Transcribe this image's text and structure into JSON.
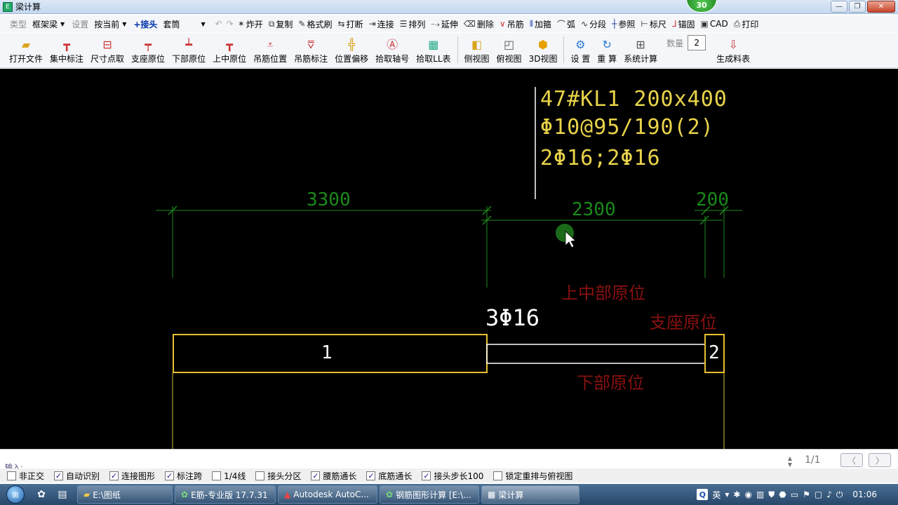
{
  "window": {
    "title": "梁计算",
    "badge": "30",
    "minimize": "—",
    "restore": "❐",
    "close": "✕"
  },
  "row1": {
    "type_label": "类型",
    "type_value": "框架梁",
    "settings_label": "设置",
    "settings_value": "按当前",
    "joint_btn": "+接头",
    "sleeve_value": "套筒",
    "commands": [
      "炸开",
      "复制",
      "格式刷",
      "打断",
      "连接",
      "排列",
      "延伸",
      "删除",
      "吊筋",
      "加箍",
      "弧",
      "分段",
      "参照",
      "标尺",
      "锚固",
      "CAD",
      "打印"
    ]
  },
  "row2": {
    "buttons": [
      "打开文件",
      "集中标注",
      "尺寸点取",
      "支座原位",
      "下部原位",
      "上中原位",
      "吊筋位置",
      "吊筋标注",
      "位置偏移",
      "拾取轴号",
      "拾取LL表"
    ],
    "view_buttons": [
      "侧视图",
      "俯视图",
      "3D视图"
    ],
    "calc_buttons": [
      "设 置",
      "重 算",
      "系统计算"
    ],
    "quantity_label": "数量",
    "quantity_value": "2",
    "generate_button": "生成料表"
  },
  "drawing": {
    "spec_line1": "47#KL1 200x400",
    "spec_line2": "Φ10@95/190(2)",
    "spec_line3": "2Φ16;2Φ16",
    "dim_1": "3300",
    "dim_2": "2300",
    "dim_3": "200",
    "top_rebar": "3Φ16",
    "label_upper_mid": "上中部原位",
    "label_support": "支座原位",
    "label_lower": "下部原位",
    "span_1": "1",
    "span_2": "2"
  },
  "cmdline": {
    "prompt": "输入:",
    "page": "1/1",
    "prev": "〈",
    "next": "〉"
  },
  "checkboxes": [
    {
      "label": "非正交",
      "checked": false
    },
    {
      "label": "自动识别",
      "checked": true
    },
    {
      "label": "连接图形",
      "checked": true
    },
    {
      "label": "标注跨",
      "checked": true
    },
    {
      "label": "1/4线",
      "checked": false
    },
    {
      "label": "接头分区",
      "checked": false
    },
    {
      "label": "腰筋通长",
      "checked": true
    },
    {
      "label": "底筋通长",
      "checked": true
    },
    {
      "label": "接头步长100",
      "checked": true
    },
    {
      "label": "锁定重排与俯视图",
      "checked": false
    }
  ],
  "taskbar": {
    "tasks": [
      "E:\\图纸",
      "E筋-专业版 17.7.31",
      "Autodesk AutoC...",
      "钢筋图形计算 [E:\\...",
      "梁计算"
    ],
    "ime": "英",
    "clock": "01:06"
  }
}
